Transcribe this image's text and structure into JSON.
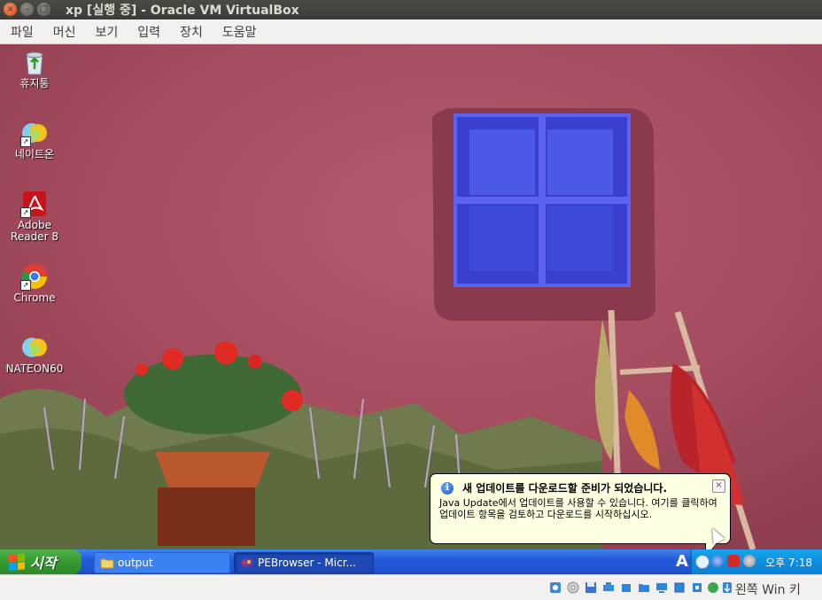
{
  "window": {
    "title": "xp [실행 중] - Oracle VM VirtualBox",
    "buttons": {
      "close": "×",
      "minimize": "–",
      "maximize": "□"
    }
  },
  "menubar": {
    "items": [
      "파일",
      "머신",
      "보기",
      "입력",
      "장치",
      "도움말"
    ]
  },
  "desktop": {
    "icons": [
      {
        "label": "휴지통",
        "icon": "recycle-bin-icon"
      },
      {
        "label": "네이트온",
        "icon": "nateon-icon"
      },
      {
        "label": "Adobe Reader 8",
        "icon": "adobe-reader-icon"
      },
      {
        "label": "Chrome",
        "icon": "chrome-icon"
      },
      {
        "label": "NATEON60",
        "icon": "nateon-icon"
      }
    ]
  },
  "taskbar": {
    "start_label": "시작",
    "tasks": [
      {
        "label": "output",
        "icon": "folder-icon"
      },
      {
        "label": "PEBrowser - Micr...",
        "icon": "pebrowser-icon"
      }
    ],
    "tray": {
      "lang_indicator": "A",
      "clock": "오후 7:18"
    }
  },
  "balloon": {
    "title": "새 업데이트를 다운로드할 준비가 되었습니다.",
    "body": "Java Update에서 업데이트를 사용할 수 있습니다. 여기를 클릭하여 업데이트 항목을 검토하고 다운로드를 시작하십시오.",
    "close": "×",
    "info_glyph": "i"
  },
  "statusbar": {
    "host_key": "왼쪽 Win 키"
  },
  "colors": {
    "ubuntu_titlebar": "#3c3b37",
    "xp_taskbar": "#2459d8",
    "xp_start": "#359a31",
    "balloon_bg": "#ffffe1"
  }
}
